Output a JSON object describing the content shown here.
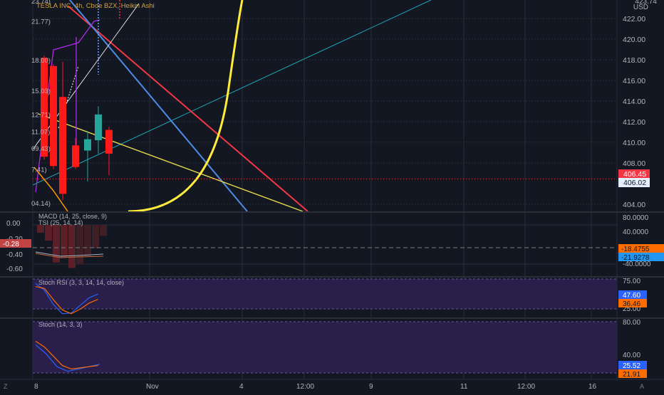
{
  "colors": {
    "background": "#131722",
    "grid": "#2a2e39",
    "bull_candle": "#26a69a",
    "bear_candle": "#ff1a1a",
    "rsi_band": "#2a1e4a",
    "stoch_k": "#2962ff",
    "stoch_d": "#ff6d00",
    "trend_yellow": "#ffeb3b",
    "trend_red": "#f23645",
    "trend_blue": "#4c8ce6",
    "trend_teal": "#1fa7b5",
    "trend_magenta": "#b02ae6"
  },
  "price_pane": {
    "title": "TESLA INC, 4h, Cboe BZX, Heikin Ashi",
    "currency": "USD",
    "top_label": "423.74",
    "left_scale_labels": [
      "23.74)",
      "21.77)",
      "18.00)",
      "15.03)",
      "12.71)",
      "11.07)",
      "09.43)",
      "7.41)",
      "04.14)"
    ],
    "scale_labels": [
      "422.00",
      "420.00",
      "418.00",
      "416.00",
      "414.00",
      "412.00",
      "410.00",
      "408.00",
      "404.00"
    ],
    "last_price": "406.45",
    "secondary_price": "406.02"
  },
  "macd_pane": {
    "macd_label": "MACD (14, 25, close, 9)",
    "tsi_label": "TSI (25, 14, 14)",
    "left_labels": [
      "0.00",
      "-0.20",
      "-0.40",
      "-0.60"
    ],
    "left_current": "-0.28",
    "right_labels": [
      "80.0000",
      "40.0000",
      "-40.0000"
    ],
    "value_orange": "-18.4755",
    "value_blue": "-21.9278",
    "histogram_levels": [
      -0.1,
      -0.2,
      -0.48,
      -0.42,
      -0.55,
      -0.5,
      -0.4,
      -0.3,
      -0.14
    ]
  },
  "stoch_rsi_pane": {
    "label": "Stoch RSI (3, 3, 14, 14, close)",
    "right_labels": [
      "75.00",
      "25.00"
    ],
    "k_value": "47.60",
    "d_value": "36.46",
    "k_levels": [
      88,
      70,
      32,
      8,
      10,
      30,
      50,
      60
    ],
    "d_levels": [
      80,
      75,
      45,
      18,
      8,
      20,
      36,
      46
    ]
  },
  "stoch_pane": {
    "label": "Stoch (14, 3, 3)",
    "right_labels": [
      "80.00",
      "40.00"
    ],
    "k_value": "25.52",
    "d_value": "21.91",
    "k_levels": [
      60,
      44,
      22,
      14,
      18,
      22,
      26
    ],
    "d_levels": [
      66,
      56,
      40,
      24,
      18,
      20,
      22,
      24
    ]
  },
  "time_axis": {
    "labels": [
      "8",
      "Nov",
      "4",
      "12:00",
      "9",
      "11",
      "12:00",
      "16"
    ],
    "left_button": "Z",
    "right_button": "A"
  },
  "chart_data": {
    "type": "candlestick",
    "title": "TESLA INC, 4h, Cboe BZX, Heikin Ashi",
    "ylim": [
      403.3,
      423.8
    ],
    "yticks": [
      404,
      408,
      410,
      412,
      414,
      416,
      418,
      420,
      422
    ],
    "candles": [
      {
        "open": 418.2,
        "high": 418.4,
        "low": 408.3,
        "close": 408.6,
        "direction": "down"
      },
      {
        "open": 417.4,
        "high": 417.6,
        "low": 407.4,
        "close": 407.7,
        "direction": "down"
      },
      {
        "open": 414.4,
        "high": 417.8,
        "low": 404.4,
        "close": 405.0,
        "direction": "down"
      },
      {
        "open": 409.7,
        "high": 410.4,
        "low": 407.4,
        "close": 407.6,
        "direction": "down"
      },
      {
        "open": 409.2,
        "high": 411.1,
        "low": 406.2,
        "close": 410.3,
        "direction": "up"
      },
      {
        "open": 410.2,
        "high": 413.5,
        "low": 408.9,
        "close": 412.7,
        "direction": "up"
      },
      {
        "open": 411.2,
        "high": 411.5,
        "low": 406.8,
        "close": 408.9,
        "direction": "down"
      }
    ],
    "last_price": 406.45
  }
}
